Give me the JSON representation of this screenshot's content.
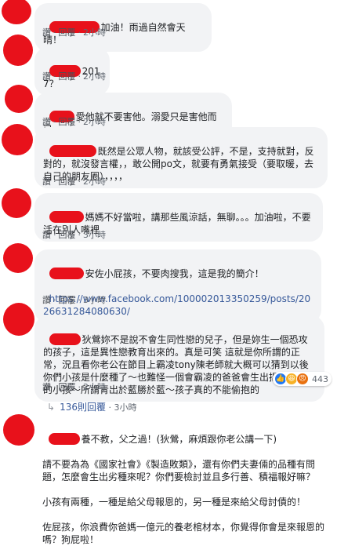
{
  "comments": [
    {
      "text": "加油！雨過自然會天晴！",
      "like": "讚",
      "reply": "回覆",
      "time": "2小時"
    },
    {
      "text": "2017？",
      "like": "讚",
      "reply": "回覆",
      "time": "2小時"
    },
    {
      "text": "愛他就不要害他。溺愛只是害他而已。",
      "like": "讚",
      "reply": "回覆",
      "time": "2小時"
    },
    {
      "text": "既然是公眾人物，就該受公評，不是，支持就對，反對的，就沒發言權，，敢公開po文，就要有勇氣接受（要取暖，去自己的朋友圈），，，，",
      "like": "讚",
      "reply": "回覆",
      "time": "2小時"
    },
    {
      "text": "媽媽不好當啦，講那些風涼話，無聊。。。加油啦，不要活在別人嘴裡",
      "like": "讚",
      "reply": "回覆",
      "time": "3小時"
    },
    {
      "text": "安佐小屁孩，不要肉搜我，這是我的簡介！",
      "link": "https://www.facebook.com/100002013350259/posts/2026631284080630/",
      "like": "讚",
      "reply": "回覆",
      "time": "3小時"
    },
    {
      "text": "狄鶯妳不是說不會生同性戀的兒子，但是妳生一個恐攻的孩子，這是異性戀教育出來的。真是可笑 這就是你所謂的正常，況且看你老公在節目上霸凌tony陳老師就大概可以猜到以後你們小孩是什麼種了～也難怪一個會霸凌的爸爸會生出揚言要恐攻的小孩～所謂青出於藍勝於藍～孩子真的不能偷抱的",
      "like": "讚",
      "reply": "回覆",
      "time": "2小時",
      "reactions": "443"
    },
    {
      "text": "養不教，父之過！(狄鶯，麻煩跟你老公講一下)\n\n請不要為為《國家社會》《製造敗類》，還有你們夫妻倆的品種有問題，怎麼會生出劣種來呢？你們要檢討並且多行善、積福報好嘛？\n\n小孩有兩種，一種是給父母報恩的，另一種是來給父母討債的！\n\n佐屁孩，你浪費你爸媽一億元的養老棺材本，你覺得你會是來報恩的嗎？狗屁啦！"
    }
  ],
  "reply_thread": {
    "count": "136則回覆",
    "time": "3小時"
  },
  "colors": {
    "redaction": "#e8111b",
    "bubble": "#f2f3f5",
    "link": "#365899"
  }
}
